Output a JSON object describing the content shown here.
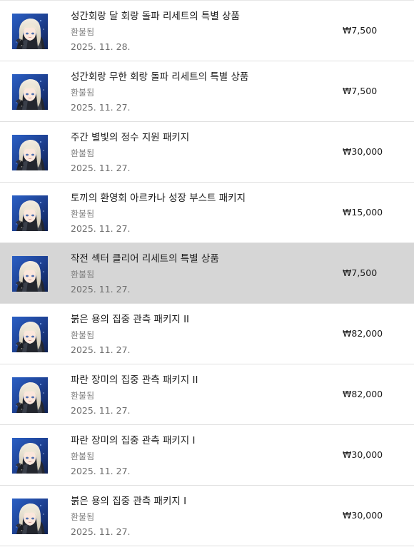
{
  "purchase_history": {
    "items": [
      {
        "title": "성간회랑 달 회랑 돌파 리세트의 특별 상품",
        "status": "환불됨",
        "date": "2025. 11. 28.",
        "price": "₩7,500",
        "selected": false,
        "icon": "game-character-thumbnail"
      },
      {
        "title": "성간회랑 무한 회랑 돌파 리세트의 특별 상품",
        "status": "환불됨",
        "date": "2025. 11. 27.",
        "price": "₩7,500",
        "selected": false,
        "icon": "game-character-thumbnail"
      },
      {
        "title": "주간 별빛의 정수 지원 패키지",
        "status": "환불됨",
        "date": "2025. 11. 27.",
        "price": "₩30,000",
        "selected": false,
        "icon": "game-character-thumbnail"
      },
      {
        "title": "토끼의 환영회 아르카나 성장 부스트 패키지",
        "status": "환불됨",
        "date": "2025. 11. 27.",
        "price": "₩15,000",
        "selected": false,
        "icon": "game-character-thumbnail"
      },
      {
        "title": "작전 섹터 클리어 리세트의 특별 상품",
        "status": "환불됨",
        "date": "2025. 11. 27.",
        "price": "₩7,500",
        "selected": true,
        "icon": "game-character-thumbnail"
      },
      {
        "title": "붉은 용의 집중 관측 패키지 II",
        "status": "환불됨",
        "date": "2025. 11. 27.",
        "price": "₩82,000",
        "selected": false,
        "icon": "game-character-thumbnail"
      },
      {
        "title": "파란 장미의 집중 관측 패키지 II",
        "status": "환불됨",
        "date": "2025. 11. 27.",
        "price": "₩82,000",
        "selected": false,
        "icon": "game-character-thumbnail"
      },
      {
        "title": "파란 장미의 집중 관측 패키지 I",
        "status": "환불됨",
        "date": "2025. 11. 27.",
        "price": "₩30,000",
        "selected": false,
        "icon": "game-character-thumbnail"
      },
      {
        "title": "붉은 용의 집중 관측 패키지 I",
        "status": "환불됨",
        "date": "2025. 11. 27.",
        "price": "₩30,000",
        "selected": false,
        "icon": "game-character-thumbnail"
      }
    ]
  },
  "colors": {
    "row_background": "#ffffff",
    "selected_row_background": "#d6d6d6",
    "divider": "#e0e0e0",
    "primary_text": "#1b1b1b",
    "secondary_text": "#808080",
    "thumbnail_background": "#1d3f8f"
  }
}
